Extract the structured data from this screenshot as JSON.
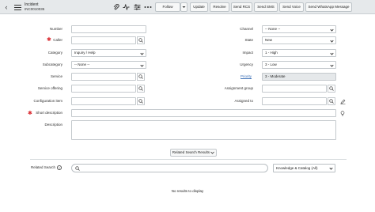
{
  "header": {
    "title": "Incident",
    "number": "INC0010035",
    "buttons": {
      "follow": "Follow",
      "update": "Update",
      "resolve": "Resolve",
      "send_rcs": "Send RCS",
      "send_sms": "Send SMS",
      "send_voice": "Send Voice",
      "send_whatsapp": "Send WhatsApp Message"
    },
    "icons": [
      "back-icon",
      "menu-icon",
      "paperclip-icon",
      "activity-icon",
      "settings-sliders-icon",
      "more-icon",
      "dropdown-caret-icon"
    ]
  },
  "form": {
    "left": {
      "number_label": "Number",
      "number_value": "",
      "caller_label": "Caller",
      "caller_value": "",
      "category_label": "Category",
      "category_value": "Inquiry / Help",
      "subcategory_label": "Subcategory",
      "subcategory_value": "-- None --",
      "service_label": "Service",
      "service_value": "",
      "service_offering_label": "Service offering",
      "service_offering_value": "",
      "config_item_label": "Configuration item",
      "config_item_value": ""
    },
    "right": {
      "channel_label": "Channel",
      "channel_value": "-- None --",
      "state_label": "State",
      "state_value": "New",
      "impact_label": "Impact",
      "impact_value": "1 - High",
      "urgency_label": "Urgency",
      "urgency_value": "3 - Low",
      "priority_label": "Priority",
      "priority_value": "3 - Moderate",
      "assignment_group_label": "Assignment group",
      "assignment_group_value": "",
      "assigned_to_label": "Assigned to",
      "assigned_to_value": ""
    },
    "short_description_label": "Short description",
    "short_description_value": "",
    "description_label": "Description",
    "description_value": ""
  },
  "related": {
    "button_label": "Related Search Results",
    "search_label": "Related Search",
    "search_value": "",
    "source_value": "Knowledge & Catalog (All)",
    "no_results": "No results to display"
  },
  "colors": {
    "header_bg": "#e6e9eb",
    "required": "#d9272d",
    "link": "#3b6fb6",
    "readonly_bg": "#e5e8ea"
  }
}
